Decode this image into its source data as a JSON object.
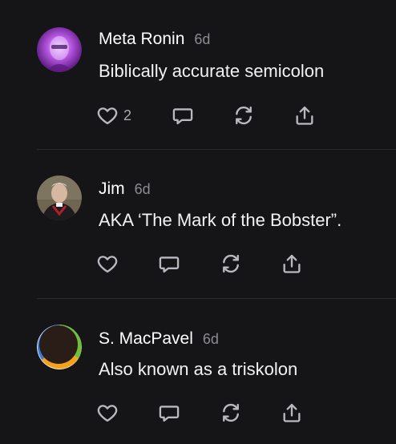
{
  "comments": [
    {
      "name": "Meta Ronin",
      "time": "6d",
      "text": "Biblically accurate semicolon",
      "likes": "2"
    },
    {
      "name": "Jim",
      "time": "6d",
      "text": "AKA ‘The Mark of the Bobster”.",
      "likes": ""
    },
    {
      "name": "S. MacPavel",
      "time": "6d",
      "text": "Also known as a triskolon",
      "likes": ""
    }
  ],
  "icons": {
    "like": "heart-icon",
    "reply": "speech-bubble-icon",
    "restack": "refresh-icon",
    "share": "share-upload-icon"
  },
  "colors": {
    "background": "#151517",
    "text": "#ffffff",
    "muted": "#8c8c93",
    "icon": "#b9b9c0",
    "divider": "#2c2c30"
  }
}
